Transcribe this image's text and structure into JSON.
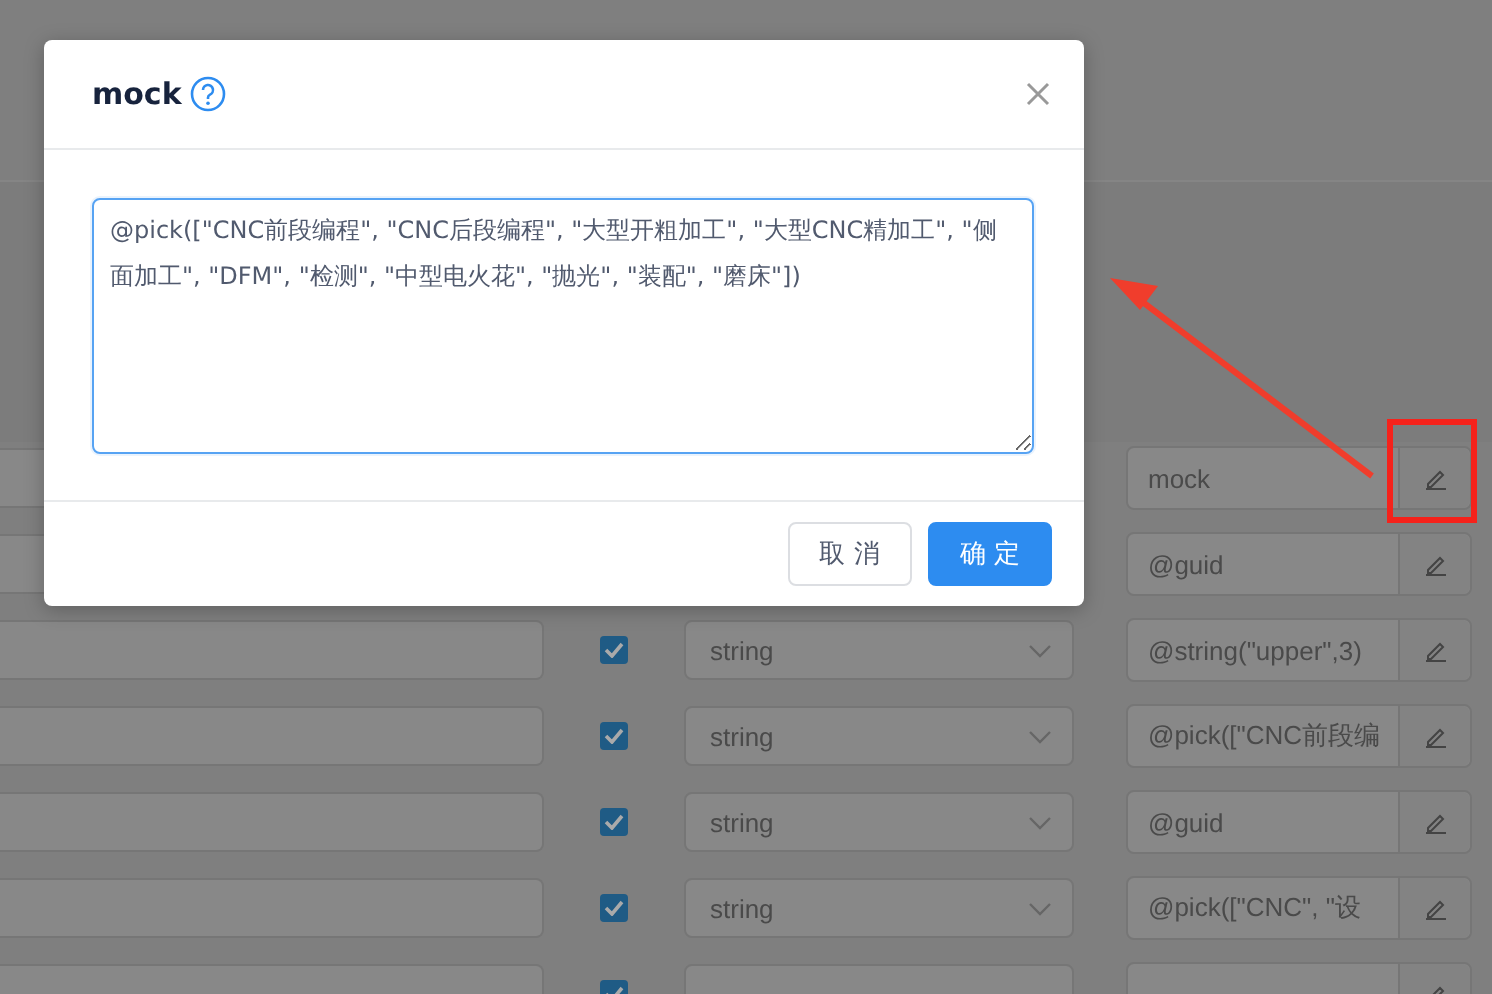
{
  "rows": [
    {
      "mock": "mock"
    },
    {
      "mock": "@guid"
    },
    {
      "checked": true,
      "type": "string",
      "mock": "@string(\"upper\",3)"
    },
    {
      "checked": true,
      "type": "string",
      "mock": "@pick([\"CNC前段编"
    },
    {
      "checked": true,
      "type": "string",
      "mock": "@guid"
    },
    {
      "checked": true,
      "type": "string",
      "mock": "@pick([\"CNC\", \"设"
    },
    {
      "checked": true
    }
  ],
  "dialog": {
    "title": "mock",
    "value": "@pick([\"CNC前段编程\", \"CNC后段编程\", \"大型开粗加工\", \"大型CNC精加工\", \"侧面加工\", \"DFM\", \"检测\", \"中型电火花\", \"抛光\", \"装配\", \"磨床\"])",
    "buttons": [
      {
        "label": "取 消",
        "kind": "default"
      },
      {
        "label": "确 定",
        "kind": "primary"
      }
    ]
  }
}
